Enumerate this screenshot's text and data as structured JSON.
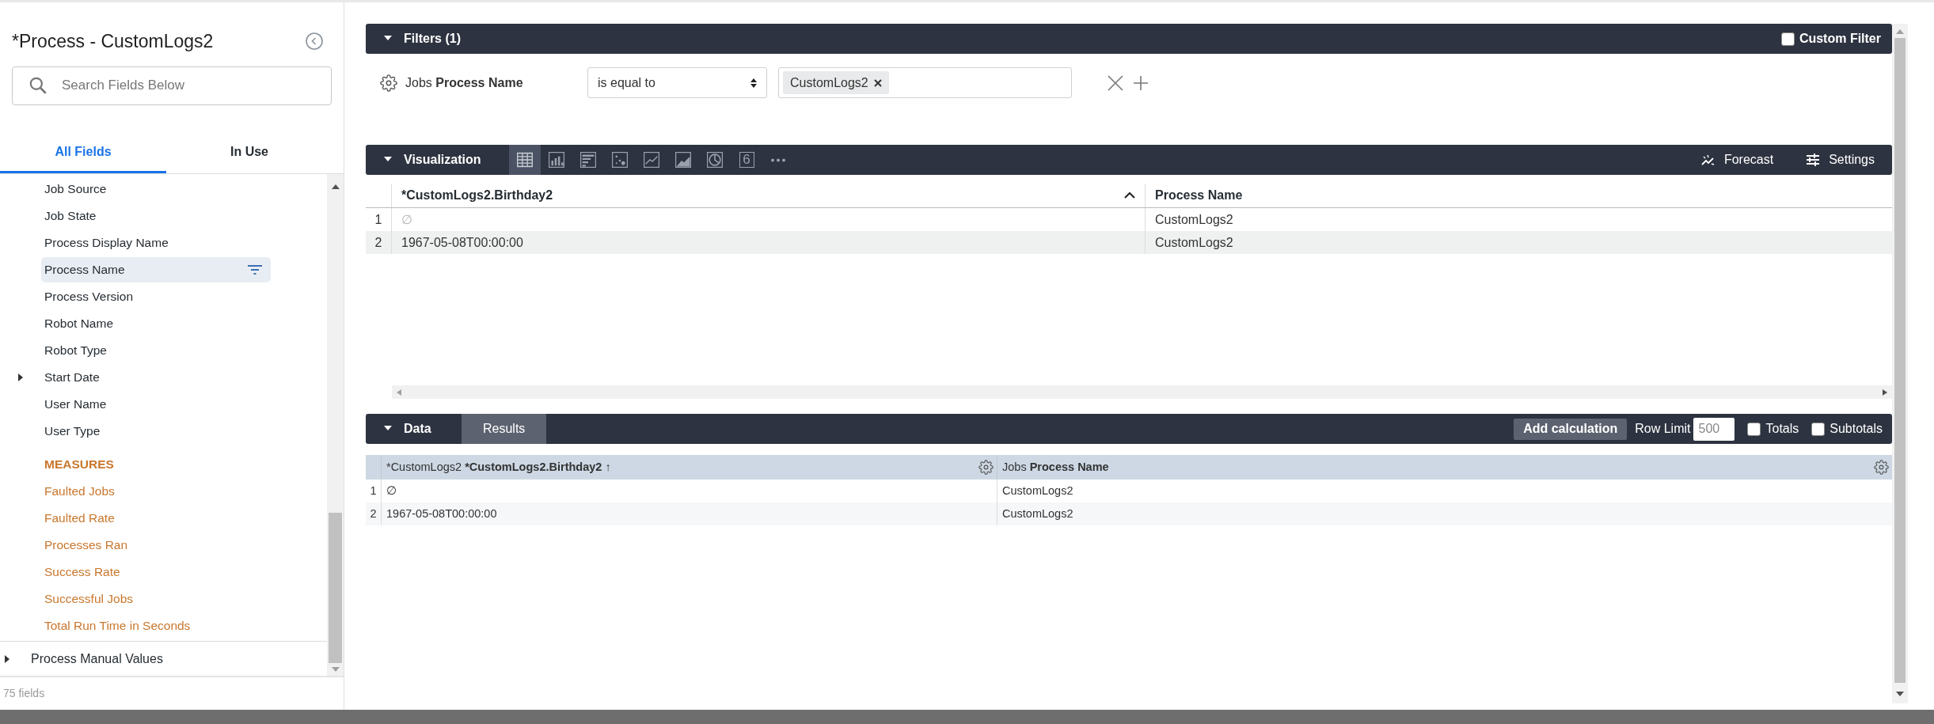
{
  "sidebar": {
    "title": "*Process - CustomLogs2",
    "search": {
      "placeholder": "Search Fields Below"
    },
    "tabs": [
      {
        "label": "All Fields",
        "selected": true
      },
      {
        "label": "In Use",
        "selected": false
      }
    ],
    "fields": [
      {
        "label": "Job Source",
        "kind": "dimension",
        "selected": false,
        "filtered": false,
        "expandable": false
      },
      {
        "label": "Job State",
        "kind": "dimension",
        "selected": false,
        "filtered": false,
        "expandable": false
      },
      {
        "label": "Process Display Name",
        "kind": "dimension",
        "selected": false,
        "filtered": false,
        "expandable": false
      },
      {
        "label": "Process Name",
        "kind": "dimension",
        "selected": true,
        "filtered": true,
        "expandable": false
      },
      {
        "label": "Process Version",
        "kind": "dimension",
        "selected": false,
        "filtered": false,
        "expandable": false
      },
      {
        "label": "Robot Name",
        "kind": "dimension",
        "selected": false,
        "filtered": false,
        "expandable": false
      },
      {
        "label": "Robot Type",
        "kind": "dimension",
        "selected": false,
        "filtered": false,
        "expandable": false
      },
      {
        "label": "Start Date",
        "kind": "dimension",
        "selected": false,
        "filtered": false,
        "expandable": true
      },
      {
        "label": "User Name",
        "kind": "dimension",
        "selected": false,
        "filtered": false,
        "expandable": false
      },
      {
        "label": "User Type",
        "kind": "dimension",
        "selected": false,
        "filtered": false,
        "expandable": false
      },
      {
        "label": "MEASURES",
        "kind": "heading",
        "selected": false,
        "filtered": false,
        "expandable": false
      },
      {
        "label": "Faulted Jobs",
        "kind": "measure",
        "selected": false,
        "filtered": false,
        "expandable": false
      },
      {
        "label": "Faulted Rate",
        "kind": "measure",
        "selected": false,
        "filtered": false,
        "expandable": false
      },
      {
        "label": "Processes Ran",
        "kind": "measure",
        "selected": false,
        "filtered": false,
        "expandable": false
      },
      {
        "label": "Success Rate",
        "kind": "measure",
        "selected": false,
        "filtered": false,
        "expandable": false
      },
      {
        "label": "Successful Jobs",
        "kind": "measure",
        "selected": false,
        "filtered": false,
        "expandable": false
      },
      {
        "label": "Total Run Time in Seconds",
        "kind": "measure",
        "selected": false,
        "filtered": false,
        "expandable": false
      }
    ],
    "group": {
      "label": "Process Manual Values",
      "expanded": false
    },
    "footer": "75 fields"
  },
  "filters": {
    "title": "Filters (1)",
    "expanded": true,
    "custom_filter": {
      "label": "Custom Filter",
      "checked": false
    },
    "filter": {
      "field_prefix": "Jobs",
      "field_name": "Process Name",
      "operator": "is equal to",
      "values": [
        "CustomLogs2"
      ]
    }
  },
  "visualization": {
    "title": "Visualization",
    "expanded": true,
    "chart_types": [
      {
        "kind": "table",
        "selected": true
      },
      {
        "kind": "column",
        "selected": false
      },
      {
        "kind": "bar",
        "selected": false
      },
      {
        "kind": "scatter",
        "selected": false
      },
      {
        "kind": "line",
        "selected": false
      },
      {
        "kind": "area",
        "selected": false
      },
      {
        "kind": "pie",
        "selected": false
      },
      {
        "kind": "single-value",
        "selected": false,
        "label": "6"
      },
      {
        "kind": "more",
        "selected": false
      }
    ],
    "actions": [
      {
        "kind": "forecast",
        "label": "Forecast"
      },
      {
        "kind": "settings",
        "label": "Settings"
      }
    ],
    "table": {
      "columns": [
        {
          "label": "*CustomLogs2.Birthday2",
          "sorted_ascending": true
        },
        {
          "label": "Process Name",
          "sorted_ascending": false
        }
      ],
      "rows": [
        {
          "index": "1",
          "cells": [
            {
              "text": "∅",
              "is_null": true
            },
            {
              "text": "CustomLogs2",
              "is_null": false
            }
          ]
        },
        {
          "index": "2",
          "cells": [
            {
              "text": "1967-05-08T00:00:00",
              "is_null": false
            },
            {
              "text": "CustomLogs2",
              "is_null": false
            }
          ]
        }
      ]
    }
  },
  "data": {
    "title": "Data",
    "expanded": true,
    "tab": "Results",
    "add_calculation": "Add calculation",
    "row_limit": {
      "label": "Row Limit",
      "value": "500"
    },
    "totals": {
      "label": "Totals",
      "checked": false
    },
    "subtotals": {
      "label": "Subtotals",
      "checked": false
    },
    "table": {
      "columns": [
        {
          "prefix": "*CustomLogs2",
          "name": "*CustomLogs2.Birthday2",
          "sort_mark": "↑"
        },
        {
          "prefix": "Jobs",
          "name": "Process Name"
        }
      ],
      "rows": [
        {
          "index": "1",
          "cells": [
            "∅",
            "CustomLogs2"
          ]
        },
        {
          "index": "2",
          "cells": [
            "1967-05-08T00:00:00",
            "CustomLogs2"
          ]
        }
      ]
    }
  }
}
